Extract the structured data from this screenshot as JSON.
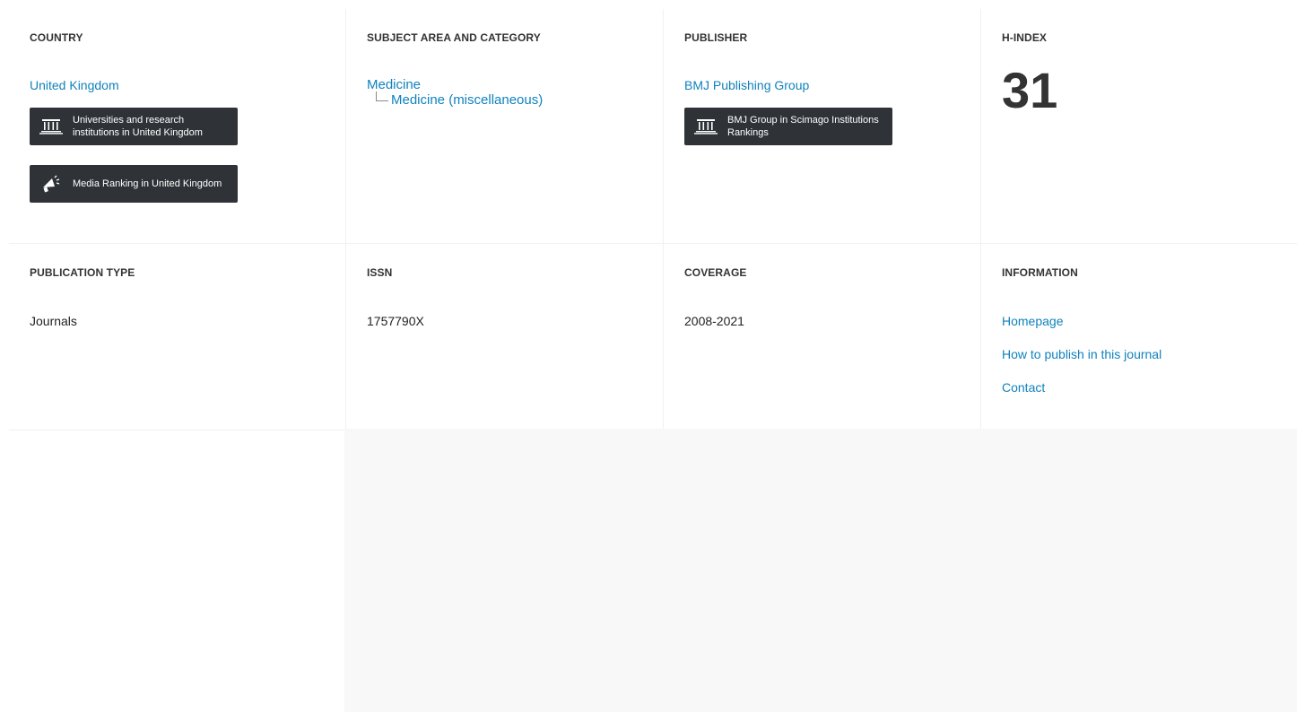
{
  "row1": {
    "country": {
      "heading": "COUNTRY",
      "value": "United Kingdom",
      "buttons": [
        {
          "label": "Universities and research institutions in United Kingdom",
          "icon": "institution-icon"
        },
        {
          "label": "Media Ranking in United Kingdom",
          "icon": "megaphone-icon"
        }
      ]
    },
    "subject": {
      "heading": "SUBJECT AREA AND CATEGORY",
      "area": "Medicine",
      "category": "Medicine (miscellaneous)"
    },
    "publisher": {
      "heading": "PUBLISHER",
      "value": "BMJ Publishing Group",
      "button": {
        "label": "BMJ Group in Scimago Institutions Rankings",
        "icon": "institution-icon"
      }
    },
    "hindex": {
      "heading": "H-INDEX",
      "value": "31"
    }
  },
  "row2": {
    "publication_type": {
      "heading": "PUBLICATION TYPE",
      "value": "Journals"
    },
    "issn": {
      "heading": "ISSN",
      "value": "1757790X"
    },
    "coverage": {
      "heading": "COVERAGE",
      "value": "2008-2021"
    },
    "information": {
      "heading": "INFORMATION",
      "links": [
        "Homepage",
        "How to publish in this journal",
        "Contact"
      ]
    }
  },
  "colors": {
    "link": "#1082bd",
    "button_bg": "#2f3338",
    "panel_bg": "#f8f8f8"
  }
}
